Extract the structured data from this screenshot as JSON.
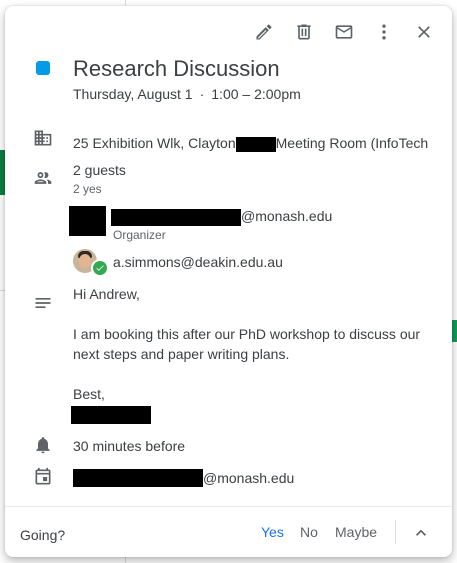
{
  "toolbar": {
    "edit_icon": "pencil-icon",
    "delete_icon": "trash-icon",
    "email_icon": "mail-icon",
    "more_icon": "more-vert-icon",
    "close_icon": "close-icon"
  },
  "event": {
    "color": "#039be5",
    "title": "Research Discussion",
    "date": "Thursday, August 1",
    "separator": "·",
    "time": "1:00 – 2:00pm",
    "location_prefix": "25 Exhibition Wlk, Clayton",
    "location_suffix": "Meeting Room (InfoTech"
  },
  "guests": {
    "count_label": "2 guests",
    "summary": "2 yes",
    "organizer_email_suffix": "@monash.edu",
    "organizer_role": "Organizer",
    "guest_email": "a.simmons@deakin.edu.au"
  },
  "description": {
    "greeting": "Hi Andrew,",
    "body": "I am booking this after our PhD workshop to discuss our next steps and paper writing plans.",
    "closing": "Best,"
  },
  "reminder": {
    "label": "30 minutes before"
  },
  "calendar": {
    "owner_suffix": "@monash.edu"
  },
  "rsvp": {
    "prompt": "Going?",
    "yes": "Yes",
    "no": "No",
    "maybe": "Maybe",
    "selected": "Yes",
    "accent": "#1a73e8"
  }
}
